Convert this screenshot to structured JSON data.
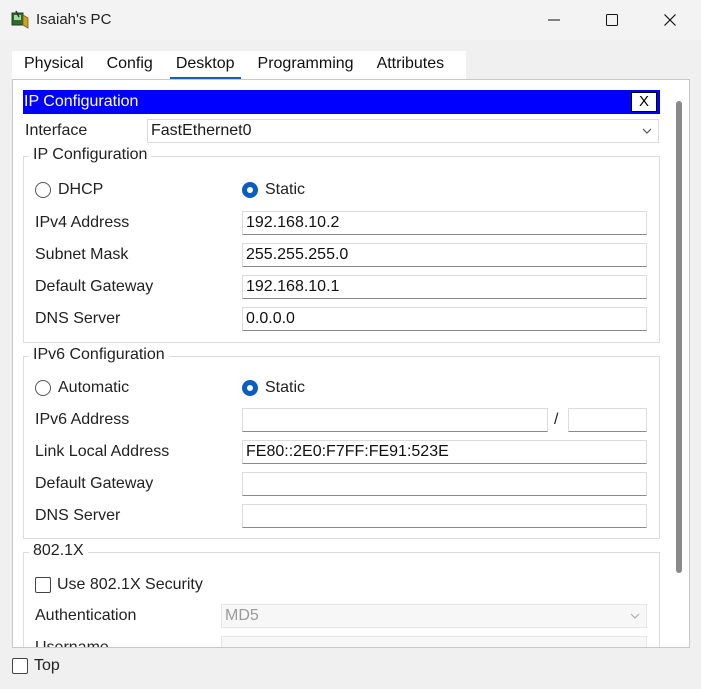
{
  "window": {
    "title": "Isaiah's PC"
  },
  "tabs": [
    "Physical",
    "Config",
    "Desktop",
    "Programming",
    "Attributes"
  ],
  "active_tab": "Desktop",
  "panel": {
    "title": "IP Configuration",
    "close_label": "X"
  },
  "interface": {
    "label": "Interface",
    "value": "FastEthernet0"
  },
  "ipv4": {
    "title": "IP Configuration",
    "dhcp_label": "DHCP",
    "static_label": "Static",
    "mode": "static",
    "address_label": "IPv4 Address",
    "address": "192.168.10.2",
    "mask_label": "Subnet Mask",
    "mask": "255.255.255.0",
    "gateway_label": "Default Gateway",
    "gateway": "192.168.10.1",
    "dns_label": "DNS Server",
    "dns": "0.0.0.0"
  },
  "ipv6": {
    "title": "IPv6 Configuration",
    "auto_label": "Automatic",
    "static_label": "Static",
    "mode": "static",
    "address_label": "IPv6 Address",
    "address": "",
    "prefix_separator": "/",
    "prefix": "",
    "link_local_label": "Link Local Address",
    "link_local": "FE80::2E0:F7FF:FE91:523E",
    "gateway_label": "Default Gateway",
    "gateway": "",
    "dns_label": "DNS Server",
    "dns": ""
  },
  "dot1x": {
    "title": "802.1X",
    "use_label": "Use 802.1X Security",
    "use_checked": false,
    "auth_label": "Authentication",
    "auth_value": "MD5",
    "username_label": "Username"
  },
  "footer": {
    "top_label": "Top",
    "top_checked": false
  },
  "colors": {
    "panel_bar": "#0000ff",
    "radio_selected": "#0a5dc2",
    "tab_underline": "#1a5fb4"
  },
  "icons": {
    "app": "pc-icon",
    "minimize": "minimize-icon",
    "maximize": "maximize-icon",
    "close": "close-icon",
    "dropdown": "chevron-down-icon"
  }
}
